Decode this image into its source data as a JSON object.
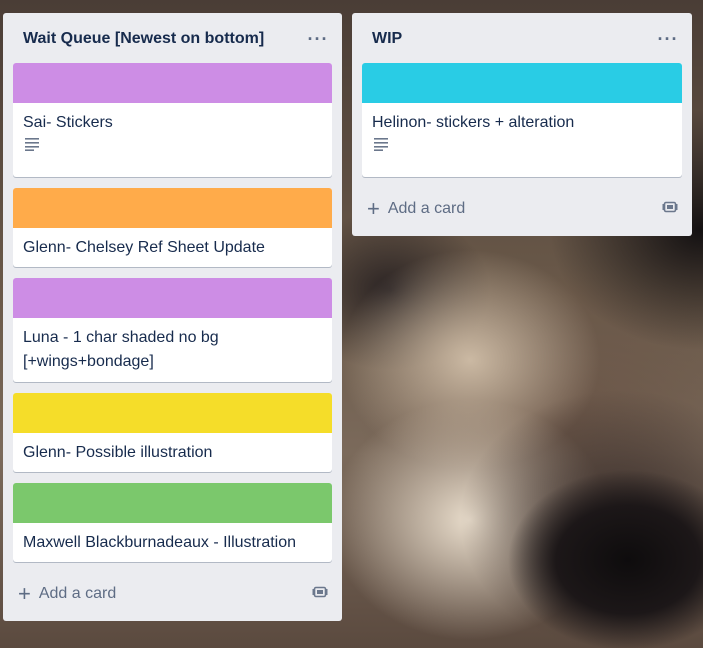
{
  "lists": [
    {
      "title": "Wait Queue [Newest on bottom]",
      "menu": "···",
      "add_card": "Add a card",
      "cards": [
        {
          "title": "Sai- Stickers",
          "label_color": "#cd8de5",
          "has_description": true
        },
        {
          "title": "Glenn- Chelsey Ref Sheet Update",
          "label_color": "#ffab4a",
          "has_description": false
        },
        {
          "title": "Luna - 1 char shaded no bg [+wings+bondage]",
          "label_color": "#cd8de5",
          "has_description": false
        },
        {
          "title": "Glenn- Possible illustration",
          "label_color": "#f5dd29",
          "has_description": false
        },
        {
          "title": "Maxwell Blackburnadeaux - Illustration",
          "label_color": "#7bc86c",
          "has_description": false
        }
      ]
    },
    {
      "title": "WIP",
      "menu": "···",
      "add_card": "Add a card",
      "cards": [
        {
          "title": "Helinon- stickers + alteration",
          "label_color": "#29cce5",
          "has_description": true
        }
      ]
    }
  ],
  "icons": {
    "add": "plus-icon",
    "template": "card-template-icon",
    "description": "description-icon",
    "menu": "more-icon"
  },
  "plus_glyph": "+"
}
